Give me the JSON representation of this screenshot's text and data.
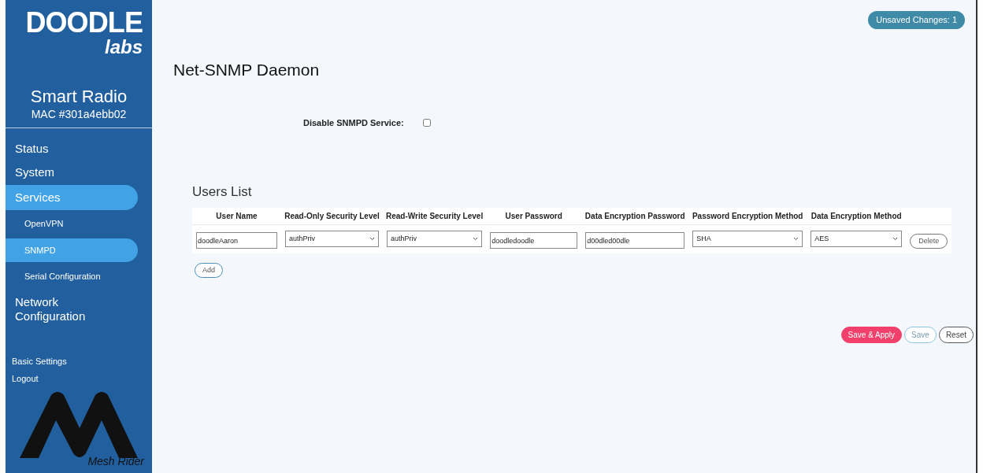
{
  "sidebar": {
    "logo": {
      "top": "DOODLE",
      "bottom": "labs"
    },
    "device": {
      "title": "Smart Radio",
      "mac": "MAC #301a4ebb02"
    },
    "nav": [
      {
        "label": "Status",
        "kind": "main",
        "selected": false
      },
      {
        "label": "System",
        "kind": "main",
        "selected": false
      },
      {
        "label": "Services",
        "kind": "main",
        "selected": true
      },
      {
        "label": "OpenVPN",
        "kind": "sub",
        "selected": false
      },
      {
        "label": "SNMPD",
        "kind": "sub",
        "selected": true
      },
      {
        "label": "Serial Configuration",
        "kind": "sub",
        "selected": false
      },
      {
        "label": "Network Configuration",
        "kind": "main",
        "selected": false
      }
    ],
    "links": [
      "Basic Settings",
      "Logout"
    ],
    "brand": "Mesh Rider"
  },
  "badge": "Unsaved Changes: 1",
  "title": "Net-SNMP Daemon",
  "disable_service": {
    "label": "Disable SNMPD Service:",
    "checked": false
  },
  "users": {
    "title": "Users List",
    "columns": [
      "User Name",
      "Read-Only Security Level",
      "Read-Write Security Level",
      "User Password",
      "Data Encryption Password",
      "Password Encryption Method",
      "Data Encryption Method"
    ],
    "rows": [
      {
        "cells": [
          {
            "kind": "input",
            "value": "doodleAaron"
          },
          {
            "kind": "select",
            "value": "authPriv"
          },
          {
            "kind": "select",
            "value": "authPriv"
          },
          {
            "kind": "input",
            "value": "doodledoodle"
          },
          {
            "kind": "input",
            "value": "d00dled00dle"
          },
          {
            "kind": "select",
            "value": "SHA"
          },
          {
            "kind": "select",
            "value": "AES"
          }
        ],
        "delete": "Delete"
      }
    ],
    "add": "Add"
  },
  "actions": [
    {
      "label": "Save & Apply",
      "kind": "primary"
    },
    {
      "label": "Save",
      "kind": "secondary"
    },
    {
      "label": "Reset",
      "kind": "plain"
    }
  ]
}
